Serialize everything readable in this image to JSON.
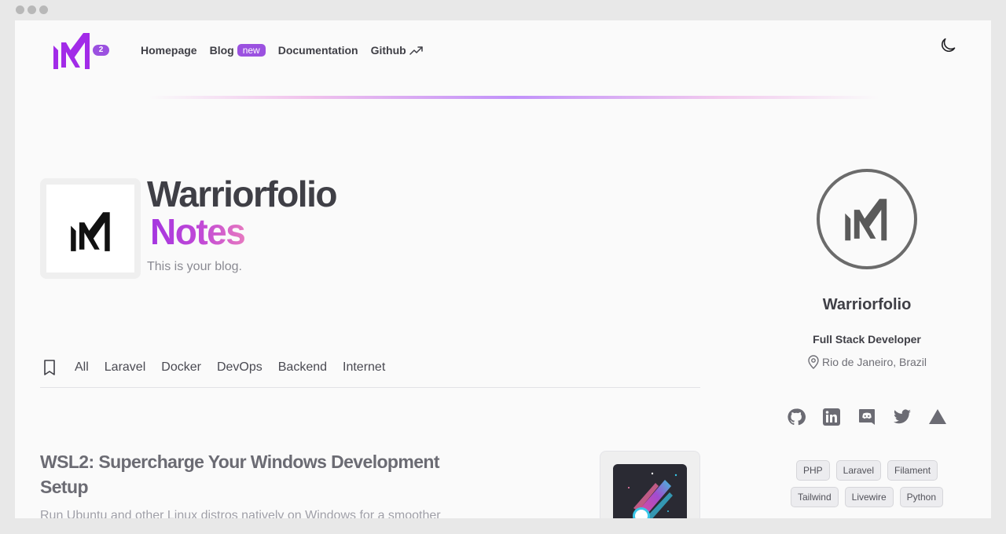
{
  "header": {
    "logo_badge": "2",
    "nav": [
      {
        "label": "Homepage"
      },
      {
        "label": "Blog",
        "badge": "new"
      },
      {
        "label": "Documentation"
      },
      {
        "label": "Github"
      }
    ],
    "icons": {
      "theme_toggle": "moon-icon",
      "github_external": "trending-up-arrow-icon"
    }
  },
  "hero": {
    "title": "Warriorfolio",
    "subtitle": "Notes",
    "description": "This is your blog."
  },
  "categories": {
    "icon": "bookmark-icon",
    "items": [
      "All",
      "Laravel",
      "Docker",
      "DevOps",
      "Backend",
      "Internet"
    ]
  },
  "post": {
    "title": "WSL2: Supercharge Your Windows Development Setup",
    "excerpt": "Run Ubuntu and other Linux distros natively on Windows for a smoother"
  },
  "profile": {
    "name": "Warriorfolio",
    "role": "Full Stack Developer",
    "location": "Rio de Janeiro, Brazil",
    "socials": [
      "github-icon",
      "linkedin-icon",
      "discord-icon",
      "twitter-icon",
      "triangle-icon"
    ],
    "tags": [
      "PHP",
      "Laravel",
      "Filament",
      "Tailwind",
      "Livewire",
      "Python"
    ]
  },
  "colors": {
    "accent": "#9b51e0",
    "text": "#3f3f46",
    "gradient_start": "#a435e0",
    "gradient_end": "#e678c0"
  }
}
